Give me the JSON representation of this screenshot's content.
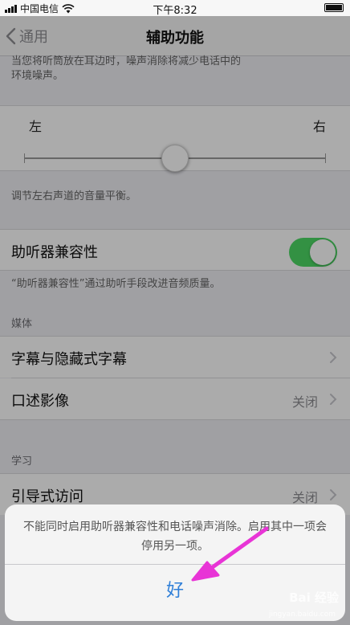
{
  "status_bar": {
    "carrier": "中国电信",
    "time": "下午8:32"
  },
  "nav": {
    "back_label": "通用",
    "title": "辅助功能"
  },
  "top_note": {
    "line1": "当您将听筒放在耳边时，噪声消除将减少电话中的",
    "line2": "环境噪声。"
  },
  "balance": {
    "left_label": "左",
    "right_label": "右",
    "value": 0.5,
    "note": "调节左右声道的音量平衡。"
  },
  "hearing_aid": {
    "label": "助听器兼容性",
    "enabled": true,
    "note": "“助听器兼容性”通过助听手段改进音频质量。"
  },
  "media": {
    "header": "媒体",
    "items": [
      {
        "label": "字幕与隐藏式字幕",
        "value": ""
      },
      {
        "label": "口述影像",
        "value": "关闭"
      }
    ]
  },
  "learning": {
    "header": "学习",
    "items": [
      {
        "label": "引导式访问",
        "value": "关闭"
      }
    ]
  },
  "alert": {
    "message": "不能同时启用助听器兼容性和电话噪声消除。启用其中一项会停用另一项。",
    "button_label": "好"
  },
  "watermark": {
    "text": "Bai 经验",
    "sub": "jingyan.baidu.com"
  },
  "colors": {
    "toggle_on": "#4cd964",
    "alert_button": "#2f7fd8",
    "arrow": "#e834d6"
  }
}
